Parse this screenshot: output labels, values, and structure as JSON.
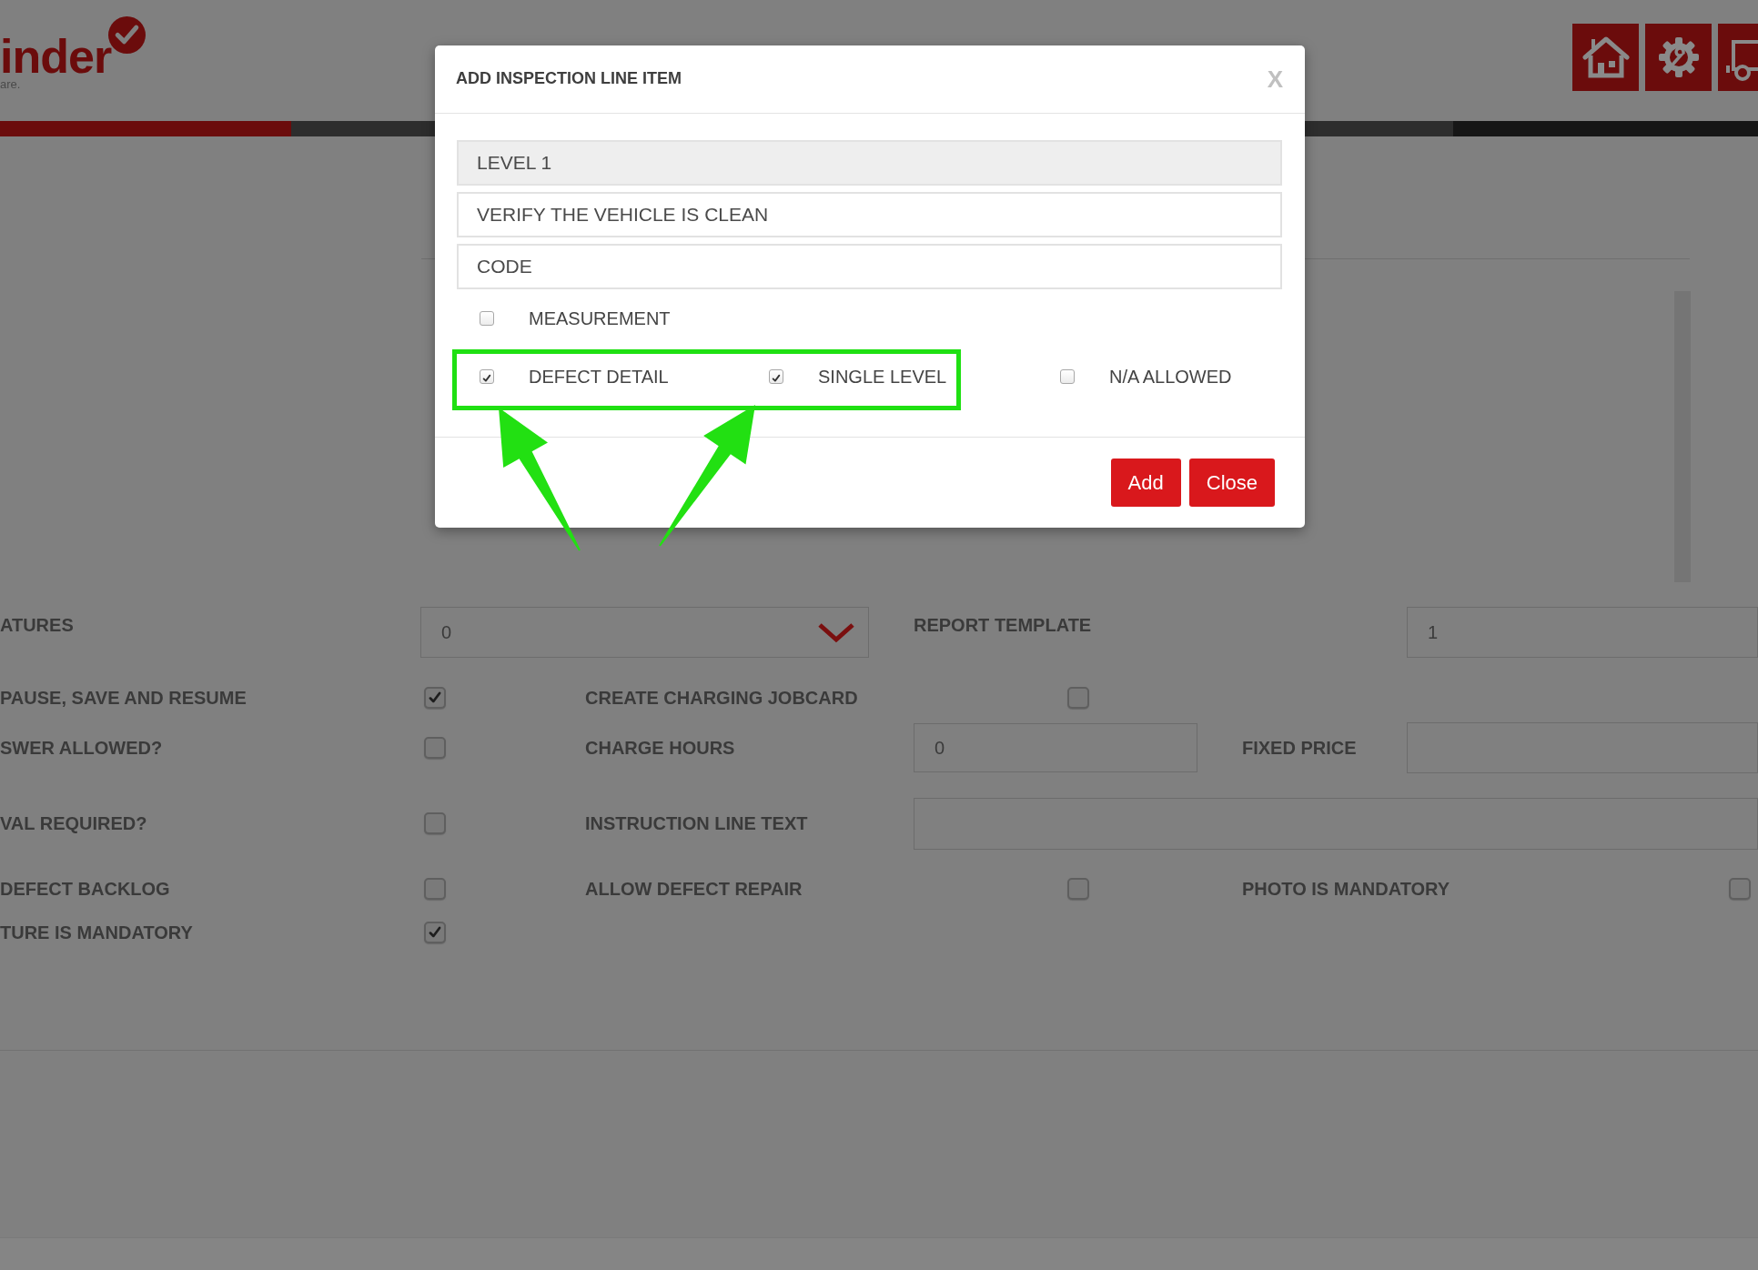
{
  "logo": {
    "name": "inder",
    "tagline": "are."
  },
  "form": {
    "rows": [
      {
        "fields": [
          {
            "label": "ATURES",
            "kind": "select",
            "value": "0"
          },
          {
            "label": "REPORT TEMPLATE",
            "kind": "text",
            "value": "1"
          }
        ]
      },
      {
        "fields": [
          {
            "label": "PAUSE, SAVE AND RESUME",
            "kind": "checkbox",
            "checked": true
          },
          {
            "label": "CREATE CHARGING JOBCARD",
            "kind": "checkbox",
            "checked": false
          }
        ]
      },
      {
        "fields": [
          {
            "label": "SWER ALLOWED?",
            "kind": "checkbox",
            "checked": false
          },
          {
            "label": "CHARGE HOURS",
            "kind": "text",
            "value": "0"
          },
          {
            "label": "FIXED PRICE",
            "kind": "text"
          }
        ]
      },
      {
        "fields": [
          {
            "label": "VAL REQUIRED?",
            "kind": "checkbox",
            "checked": false
          },
          {
            "label": "INSTRUCTION LINE TEXT",
            "kind": "wide_text"
          }
        ]
      },
      {
        "fields": [
          {
            "label": "DEFECT BACKLOG",
            "kind": "checkbox",
            "checked": false
          },
          {
            "label": "ALLOW DEFECT REPAIR",
            "kind": "checkbox",
            "checked": false
          },
          {
            "label": "PHOTO IS MANDATORY",
            "kind": "checkbox",
            "checked": false
          }
        ]
      },
      {
        "fields": [
          {
            "label": "TURE IS MANDATORY",
            "kind": "checkbox",
            "checked": true
          }
        ]
      }
    ]
  },
  "dialog": {
    "title": "ADD INSPECTION LINE ITEM",
    "close": "X",
    "fields": [
      {
        "kind": "readonly",
        "value": "LEVEL 1"
      },
      {
        "kind": "text",
        "value": "VERIFY THE VEHICLE IS CLEAN"
      },
      {
        "kind": "text",
        "placeholder": "CODE"
      }
    ],
    "option_rows": [
      {
        "options": [
          {
            "label": "MEASUREMENT",
            "checked": false
          }
        ]
      },
      {
        "options": [
          {
            "label": "DEFECT DETAIL",
            "checked": true
          },
          {
            "label": "SINGLE LEVEL",
            "checked": true
          },
          {
            "label": "N/A ALLOWED",
            "checked": false
          }
        ]
      }
    ],
    "buttons": [
      "Add",
      "Close"
    ]
  }
}
